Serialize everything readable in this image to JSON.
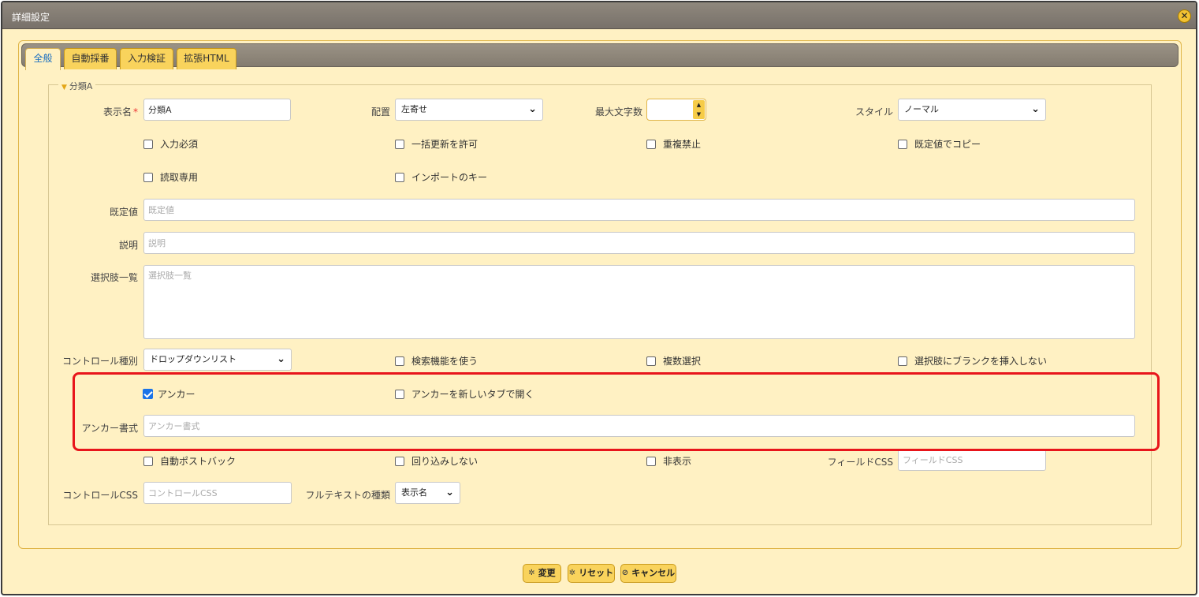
{
  "window": {
    "title": "詳細設定"
  },
  "tabs": [
    {
      "label": "全般",
      "active": true
    },
    {
      "label": "自動採番",
      "active": false
    },
    {
      "label": "入力検証",
      "active": false
    },
    {
      "label": "拡張HTML",
      "active": false
    }
  ],
  "section": {
    "legend": "分類A"
  },
  "fields": {
    "display_name": {
      "label": "表示名",
      "required_mark": "*",
      "value": "分類A"
    },
    "alignment": {
      "label": "配置",
      "value": "左寄せ"
    },
    "max_length": {
      "label": "最大文字数",
      "value": ""
    },
    "style": {
      "label": "スタイル",
      "value": "ノーマル"
    },
    "default_value": {
      "label": "既定値",
      "placeholder": "既定値"
    },
    "description": {
      "label": "説明",
      "placeholder": "説明"
    },
    "choices": {
      "label": "選択肢一覧",
      "placeholder": "選択肢一覧"
    },
    "control_type": {
      "label": "コントロール種別",
      "value": "ドロップダウンリスト"
    },
    "anchor_format": {
      "label": "アンカー書式",
      "placeholder": "アンカー書式"
    },
    "field_css": {
      "label": "フィールドCSS",
      "placeholder": "フィールドCSS"
    },
    "control_css": {
      "label": "コントロールCSS",
      "placeholder": "コントロールCSS"
    },
    "fulltext_type": {
      "label": "フルテキストの種類",
      "value": "表示名"
    }
  },
  "checkboxes": {
    "required": {
      "label": "入力必須",
      "checked": false
    },
    "allow_bulk_update": {
      "label": "一括更新を許可",
      "checked": false
    },
    "no_duplicates": {
      "label": "重複禁止",
      "checked": false
    },
    "copy_default": {
      "label": "既定値でコピー",
      "checked": false
    },
    "read_only": {
      "label": "読取専用",
      "checked": false
    },
    "import_key": {
      "label": "インポートのキー",
      "checked": false
    },
    "use_search": {
      "label": "検索機能を使う",
      "checked": false
    },
    "multiple_select": {
      "label": "複数選択",
      "checked": false
    },
    "no_blank_choice": {
      "label": "選択肢にブランクを挿入しない",
      "checked": false
    },
    "anchor": {
      "label": "アンカー",
      "checked": true
    },
    "anchor_new_tab": {
      "label": "アンカーを新しいタブで開く",
      "checked": false
    },
    "auto_postback": {
      "label": "自動ポストバック",
      "checked": false
    },
    "no_wrap": {
      "label": "回り込みしない",
      "checked": false
    },
    "hidden": {
      "label": "非表示",
      "checked": false
    }
  },
  "buttons": {
    "change": "変更",
    "reset": "リセット",
    "cancel": "キャンセル"
  },
  "colors": {
    "background": "#fff1c3",
    "accent": "#f9d35c",
    "highlight": "#e8151b",
    "titlebar": "#847c70"
  }
}
